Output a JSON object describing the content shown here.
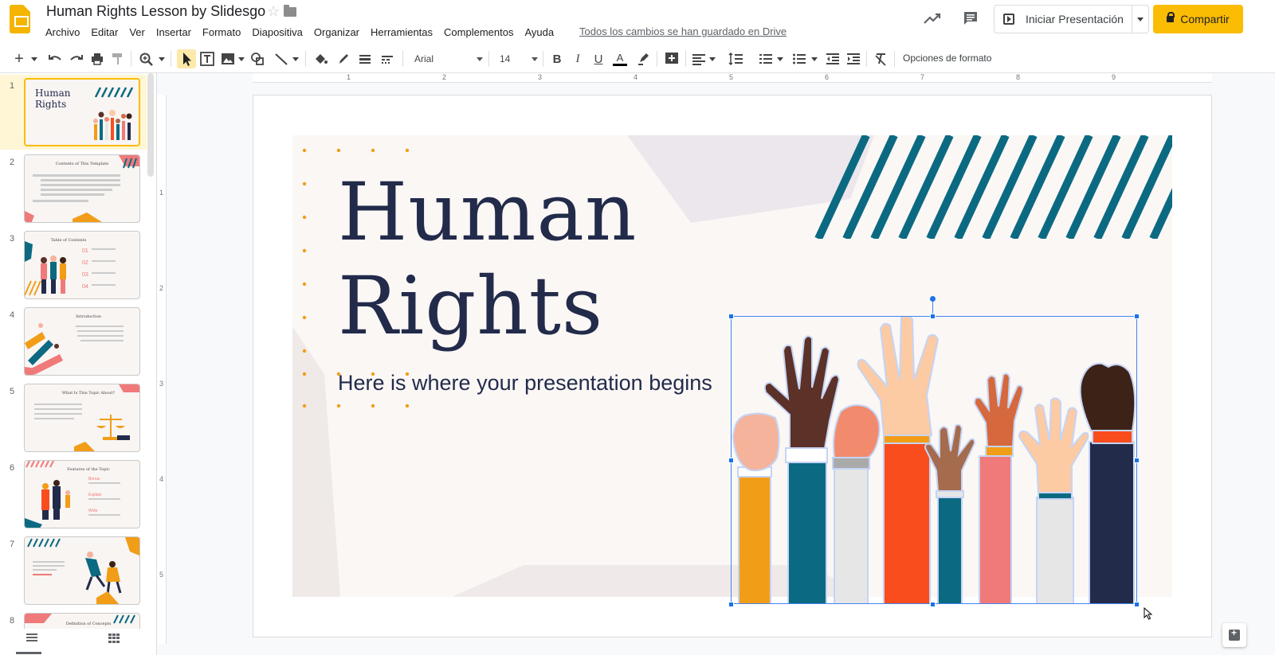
{
  "header": {
    "doc_title": "Human Rights Lesson by Slidesgo",
    "menu": [
      "Archivo",
      "Editar",
      "Ver",
      "Insertar",
      "Formato",
      "Diapositiva",
      "Organizar",
      "Herramientas",
      "Complementos",
      "Ayuda"
    ],
    "saved_status": "Todos los cambios se han guardado en Drive",
    "present_label": "Iniciar Presentación",
    "share_label": "Compartir",
    "accent_color": "#fbbc04"
  },
  "toolbar": {
    "font_family": "Arial",
    "font_size": "14",
    "format_options": "Opciones de formato"
  },
  "sidebar": {
    "slides": [
      {
        "num": "1",
        "title": "Human Rights",
        "selected": true
      },
      {
        "num": "2",
        "title": "Contents of This Template"
      },
      {
        "num": "3",
        "title": "Table of Contents"
      },
      {
        "num": "4",
        "title": "Introduction"
      },
      {
        "num": "5",
        "title": "What Is This Topic About?"
      },
      {
        "num": "6",
        "title": "Features of the Topic"
      },
      {
        "num": "7",
        "title": ""
      },
      {
        "num": "8",
        "title": "Definition of Concepts"
      }
    ]
  },
  "ruler": {
    "h_marks": [
      "1",
      "2",
      "3",
      "4",
      "5",
      "6",
      "7",
      "8",
      "9"
    ],
    "v_marks": [
      "1",
      "2",
      "3",
      "4",
      "5"
    ]
  },
  "slide": {
    "title_line1": "Human",
    "title_line2": "Rights",
    "subtitle": "Here is where your presentation begins",
    "title_color": "#232b4b",
    "stripe_color": "#0b6a82"
  }
}
